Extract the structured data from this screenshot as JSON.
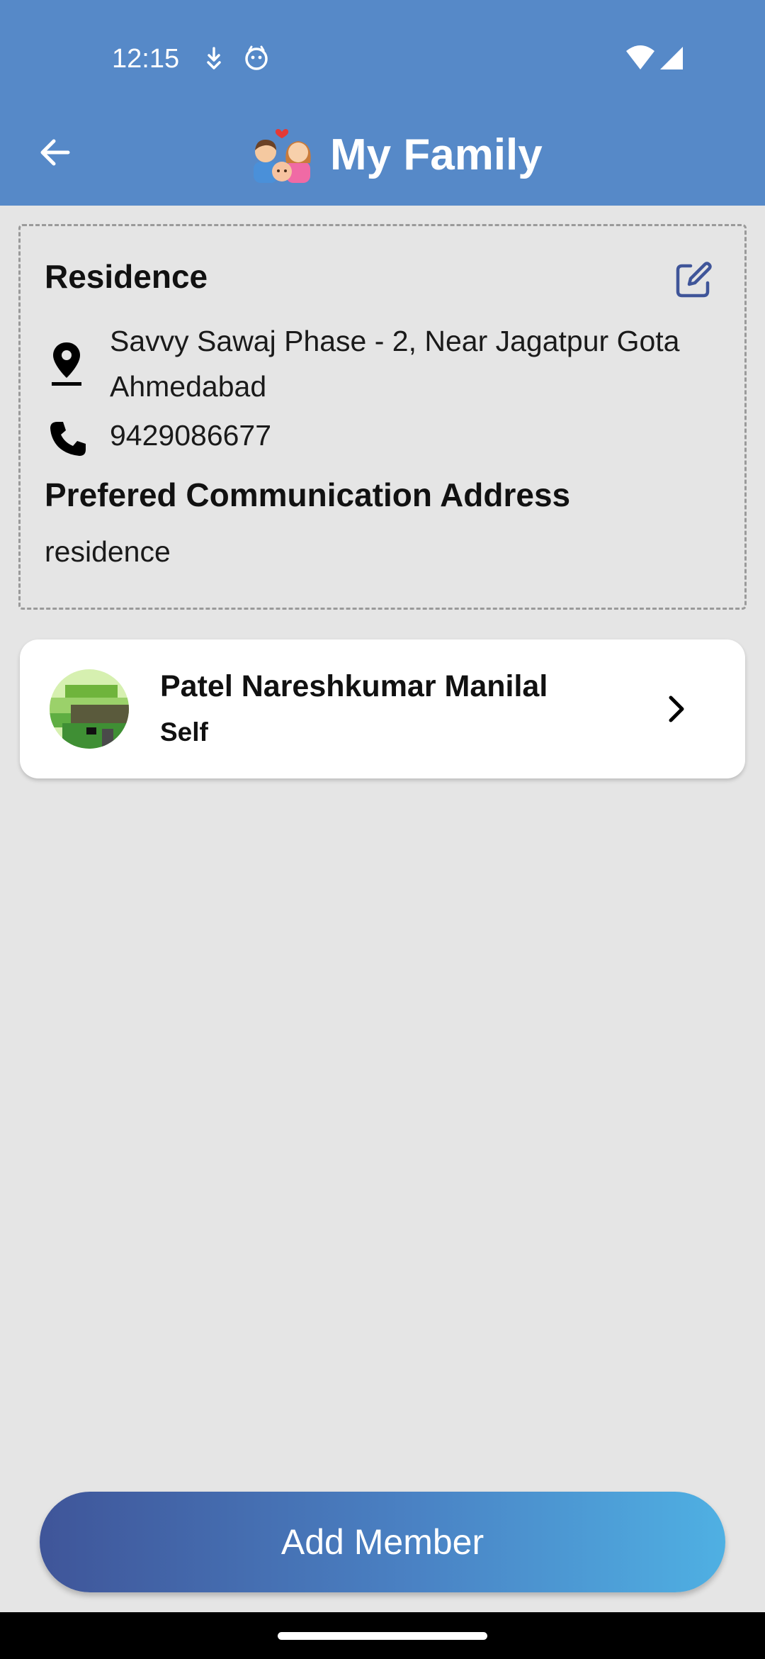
{
  "status_bar": {
    "time": "12:15",
    "icons": [
      "download-notification-icon",
      "cat-notification-icon",
      "wifi-icon",
      "signal-icon"
    ]
  },
  "app_bar": {
    "title": "My Family",
    "back_icon": "back-arrow-icon",
    "title_icon": "family-emoji-icon"
  },
  "residence": {
    "title": "Residence",
    "edit_icon": "edit-icon",
    "address_line1": "Savvy Sawaj Phase - 2, Near Jagatpur Gota",
    "address_line2": "Ahmedabad",
    "phone": "9429086677",
    "preferred_title": "Prefered Communication Address",
    "preferred_value": "residence"
  },
  "members": [
    {
      "name": "Patel Nareshkumar Manilal",
      "relation": "Self"
    }
  ],
  "add_button": {
    "label": "Add Member"
  },
  "colors": {
    "app_bar": "#5689c8",
    "background": "#e5e5e5",
    "edit_icon": "#3f5599",
    "button_gradient_start": "#3f5599",
    "button_gradient_end": "#4fb0e3"
  }
}
